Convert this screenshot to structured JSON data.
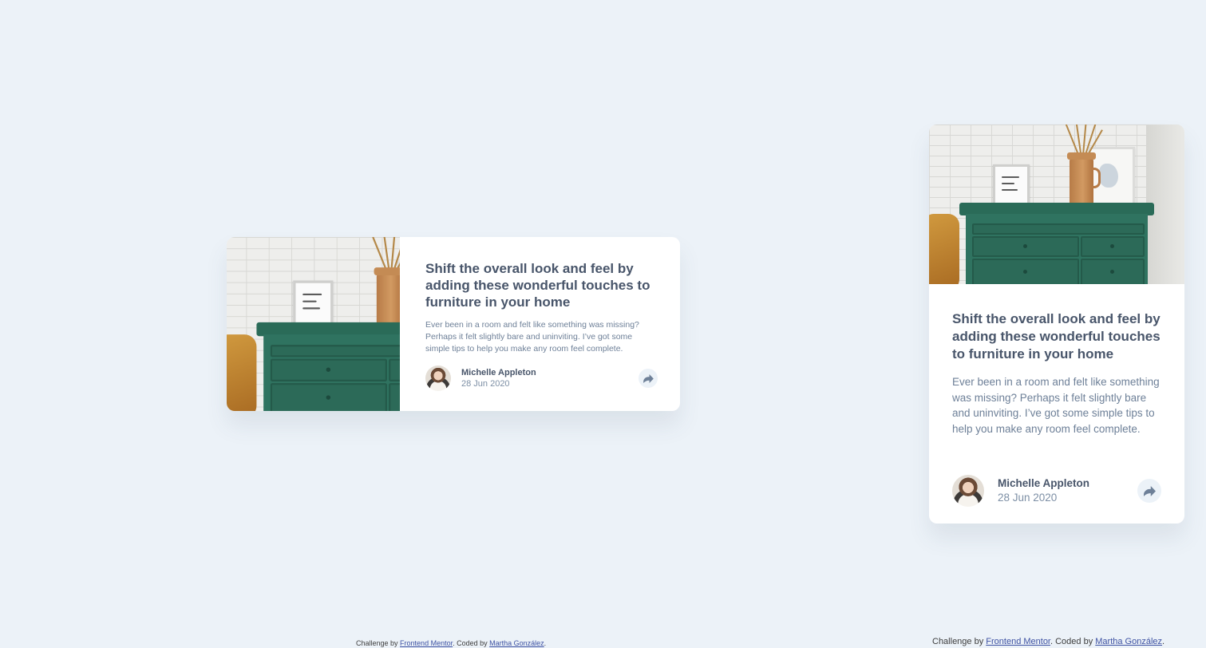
{
  "article": {
    "title": "Shift the overall look and feel by adding these wonderful touches to furniture in your home",
    "excerpt": "Ever been in a room and felt like something was missing? Perhaps it felt slightly bare and uninviting. I’ve got some simple tips to help you make any room feel complete.",
    "image_alt": "drawers",
    "author": {
      "name": "Michelle Appleton",
      "date": "28 Jun 2020"
    },
    "share_icon": "share-arrow-icon"
  },
  "attribution": {
    "prefix": "Challenge by ",
    "challenge_link": "Frontend Mentor",
    "middle": ". Coded by ",
    "coder_link": "Martha González",
    "suffix": "."
  },
  "colors": {
    "background": "#ecf2f8",
    "card": "#ffffff",
    "title": "#48556a",
    "text": "#6e8098",
    "link": "#3e52a3"
  }
}
